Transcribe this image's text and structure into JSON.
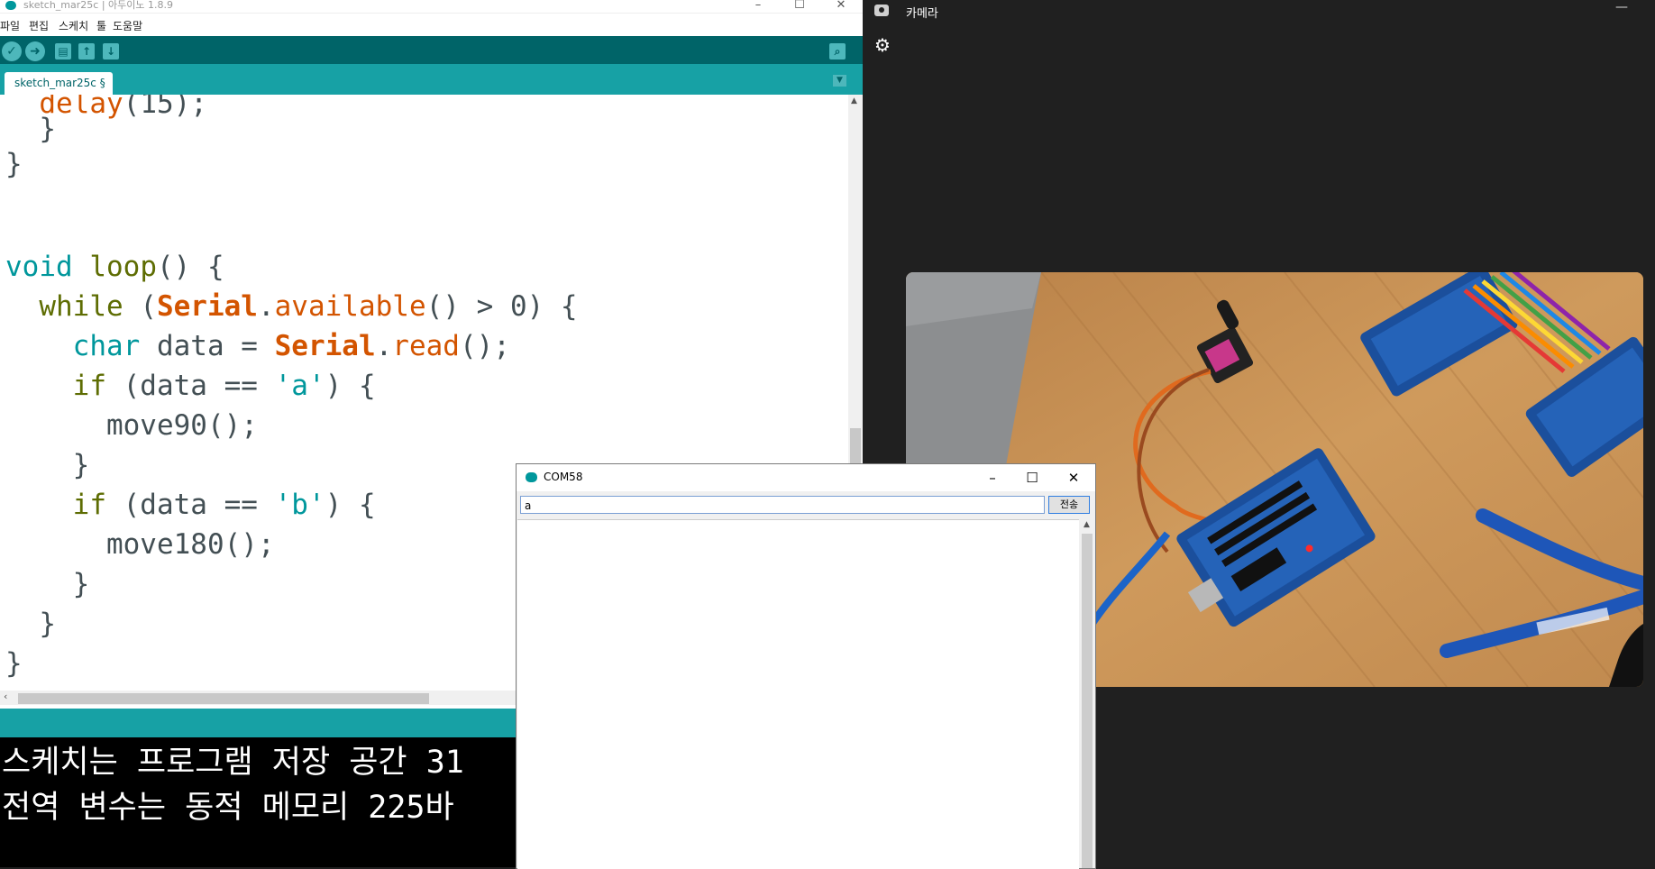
{
  "arduino": {
    "title": "sketch_mar25c | 아두이노 1.8.9",
    "menu": [
      "파일",
      "편집",
      "스케치",
      "툴",
      "도움말"
    ],
    "tab_label": "sketch_mar25c §",
    "code": {
      "l1a": "  ",
      "l1b": "delay",
      "l1c": "(15);",
      "l2": "  }",
      "l3": "}",
      "l4a": "void",
      "l4b": " ",
      "l4c": "loop",
      "l4d": "() {",
      "l5a": "  ",
      "l5b": "while",
      "l5c": " (",
      "l5d": "Serial",
      "l5e": ".",
      "l5f": "available",
      "l5g": "() > 0) {",
      "l6a": "    ",
      "l6b": "char",
      "l6c": " data = ",
      "l6d": "Serial",
      "l6e": ".",
      "l6f": "read",
      "l6g": "();",
      "l7a": "    ",
      "l7b": "if",
      "l7c": " (data == ",
      "l7d": "'a'",
      "l7e": ") {",
      "l8": "      move90();",
      "l9": "    }",
      "l10a": "    ",
      "l10b": "if",
      "l10c": " (data == ",
      "l10d": "'b'",
      "l10e": ") {",
      "l11": "      move180();",
      "l12": "    }",
      "l13": "  }",
      "l14": "}"
    },
    "console": [
      "스케치는 프로그램 저장 공간 31",
      "전역 변수는 동적 메모리 225바"
    ]
  },
  "camera": {
    "title": "카메라"
  },
  "serial_monitor": {
    "title": "COM58",
    "input_value": "a",
    "send_label": "전송"
  },
  "colors": {
    "arduino_dark_teal": "#006468",
    "arduino_teal": "#17a1a5",
    "keyword": "#00979c",
    "class_orange": "#d35400",
    "camera_bg": "#202020"
  }
}
